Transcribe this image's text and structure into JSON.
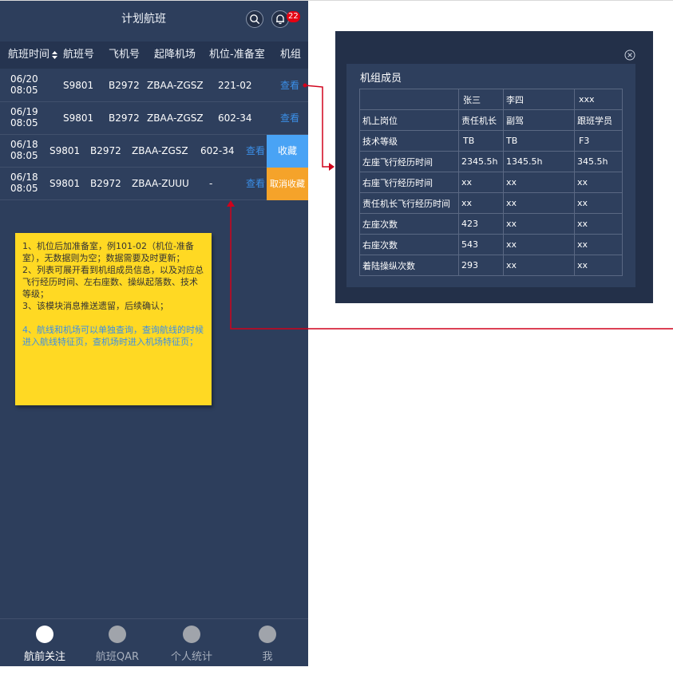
{
  "header": {
    "title": "计划航班",
    "notification_count": "22"
  },
  "table": {
    "columns": [
      "航班时间",
      "航班号",
      "飞机号",
      "起降机场",
      "机位-准备室",
      "机组"
    ],
    "rows": [
      {
        "date": "06/20",
        "time": "08:05",
        "flight": "S9801",
        "aircraft": "B2972",
        "route": "ZBAA-ZGSZ",
        "gate": "221-02",
        "view": "查看"
      },
      {
        "date": "06/19",
        "time": "08:05",
        "flight": "S9801",
        "aircraft": "B2972",
        "route": "ZBAA-ZGSZ",
        "gate": "602-34",
        "view": "查看"
      },
      {
        "date": "06/18",
        "time": "08:05",
        "flight": "S9801",
        "aircraft": "B2972",
        "route": "ZBAA-ZGSZ",
        "gate": "602-34",
        "view": "查看",
        "action": "收藏"
      },
      {
        "date": "06/18",
        "time": "08:05",
        "flight": "S9801",
        "aircraft": "B2972",
        "route": "ZBAA-ZUUU",
        "gate": "-",
        "view": "查看",
        "action": "取消收藏"
      }
    ]
  },
  "tabbar": {
    "tabs": [
      {
        "label": "航前关注",
        "active": true
      },
      {
        "label": "航班QAR",
        "active": false
      },
      {
        "label": "个人统计",
        "active": false
      },
      {
        "label": "我",
        "active": false
      }
    ]
  },
  "note": {
    "lines": [
      "1、机位后加准备室，例101-02（机位-准备室），无数据则为空；数据需要及时更新；",
      "2、列表可展开看到机组成员信息，以及对应总飞行经历时间、左右座数、操纵起落数、技术等级；",
      "3、该模块消息推送遗留，后续确认；"
    ],
    "blue_text": "4、航线和机场可以单独查询，查询航线的时候进入航线特征页，查机场时进入机场特征页；"
  },
  "crew": {
    "title": "机组成员",
    "table": [
      [
        "",
        "张三",
        "李四",
        "xxx"
      ],
      [
        "机上岗位",
        "责任机长",
        "副驾",
        "跟班学员"
      ],
      [
        "技术等级",
        "TB",
        "TB",
        "F3"
      ],
      [
        "左座飞行经历时间",
        "2345.5h",
        "1345.5h",
        "345.5h"
      ],
      [
        "右座飞行经历时间",
        "xx",
        "xx",
        "xx"
      ],
      [
        "责任机长飞行经历时间",
        "xx",
        "xx",
        "xx"
      ],
      [
        "左座次数",
        "423",
        "xx",
        "xx"
      ],
      [
        "右座次数",
        "543",
        "xx",
        "xx"
      ],
      [
        "着陆操纵次数",
        "293",
        "xx",
        "xx"
      ]
    ]
  },
  "colors": {
    "panel_bg": "#2d3e5c",
    "link": "#3b8fe8",
    "fav": "#49a3f5",
    "unfav": "#f5a32a",
    "badge": "#e60012",
    "note": "#ffd923",
    "connector": "#d0021b"
  },
  "icons": [
    "search-icon",
    "bell-icon",
    "sort-icon",
    "close-circle-icon"
  ]
}
